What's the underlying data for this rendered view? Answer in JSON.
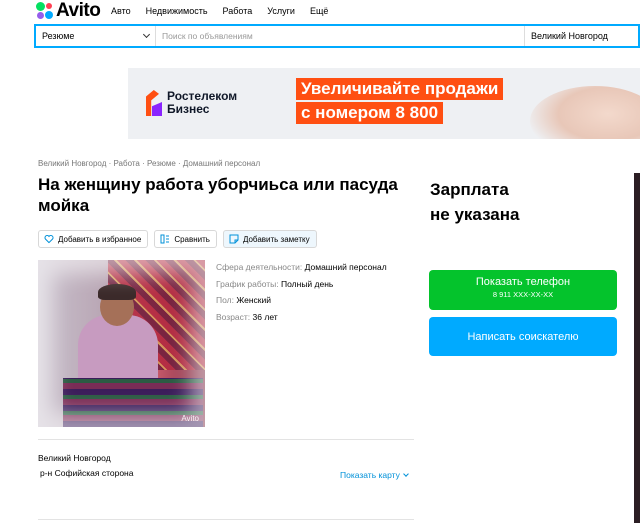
{
  "nav": {
    "logo": "Avito",
    "links": [
      "Авто",
      "Недвижимость",
      "Работа",
      "Услуги",
      "Ещё"
    ]
  },
  "search": {
    "category": "Резюме",
    "placeholder": "Поиск по объявлениям",
    "city": "Великий Новгород"
  },
  "banner": {
    "brand_line1": "Ростелеком",
    "brand_line2": "Бизнес",
    "promo_line1": "Увеличивайте продажи",
    "promo_line2": "с номером 8 800"
  },
  "breadcrumbs": [
    "Великий Новгород",
    "Работа",
    "Резюме",
    "Домашний персонал"
  ],
  "listing": {
    "title": "На женщину работа уборчиьса или пасуда мойка",
    "actions": {
      "favorite": "Добавить в избранное",
      "compare": "Сравнить",
      "note": "Добавить заметку"
    },
    "photo_watermark": "Avito",
    "params": [
      {
        "key": "Сфера деятельности:",
        "value": "Домашний персонал"
      },
      {
        "key": "График работы:",
        "value": "Полный день"
      },
      {
        "key": "Пол:",
        "value": "Женский"
      },
      {
        "key": "Возраст:",
        "value": "36 лет"
      }
    ],
    "location": {
      "city": "Великий Новгород",
      "district": "р-н Софийская сторона",
      "map_link": "Показать карту"
    }
  },
  "sidebar": {
    "salary_line1": "Зарплата",
    "salary_line2": "не указана",
    "phone_button": "Показать телефон",
    "phone_number": "8 911 XXX-XX-XX",
    "message_button": "Написать соискателю"
  },
  "colors": {
    "accent_blue": "#00aaff",
    "phone_green": "#04c32c",
    "promo_orange": "#ff4f12",
    "link_blue": "#0091d9"
  }
}
